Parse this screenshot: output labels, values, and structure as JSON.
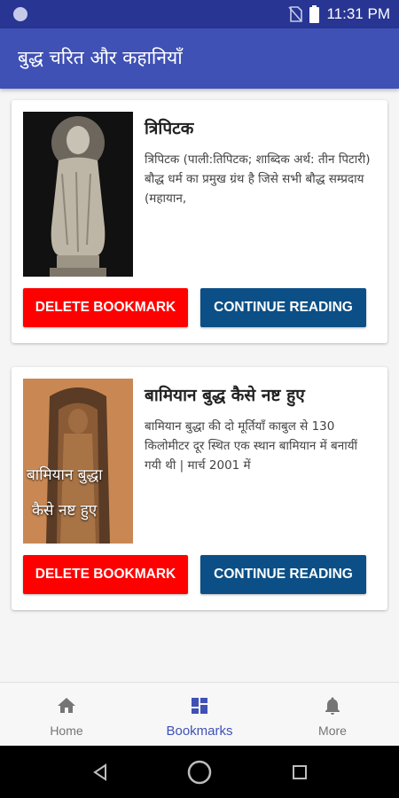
{
  "status": {
    "time": "11:31 PM"
  },
  "appbar": {
    "title": "बुद्ध चरित और कहानियाँ"
  },
  "cards": [
    {
      "title": "त्रिपिटक",
      "description": "त्रिपिटक (पाली:तिपिटक; शाब्दिक अर्थ: तीन पिटारी) बौद्ध धर्म का प्रमुख ग्रंथ है जिसे सभी बौद्ध सम्प्रदाय (महायान,",
      "delete_label": "DELETE BOOKMARK",
      "continue_label": "CONTINUE READING"
    },
    {
      "title": "बामियान बुद्ध कैसे नष्ट हुए",
      "description": "बामियान बुद्धा की दो मूर्तियाँ काबुल से 130 किलोमीटर दूर स्थित एक स्थान बामियान में बनायीं गयी थी | मार्च 2001 में",
      "image_caption_1": "बामियान बुद्धा",
      "image_caption_2": "कैसे नष्ट हुए",
      "delete_label": "DELETE BOOKMARK",
      "continue_label": "CONTINUE READING"
    }
  ],
  "bottom_nav": [
    {
      "label": "Home",
      "icon": "home-icon"
    },
    {
      "label": "Bookmarks",
      "icon": "dashboard-icon",
      "active": true
    },
    {
      "label": "More",
      "icon": "bell-icon"
    }
  ],
  "colors": {
    "primary": "#3f51b5",
    "primary_dark": "#283593",
    "delete": "#ff0000",
    "continue": "#0b4f86"
  }
}
